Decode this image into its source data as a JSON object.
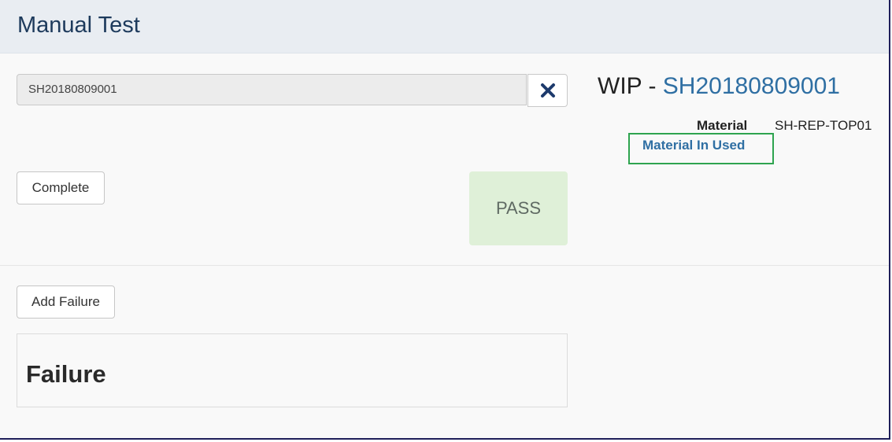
{
  "header": {
    "title": "Manual Test"
  },
  "scan": {
    "value": "SH20180809001",
    "clear_icon": "close-icon"
  },
  "wip": {
    "prefix": "WIP - ",
    "id": "SH20180809001"
  },
  "material": {
    "label": "Material",
    "value": "SH-REP-TOP01",
    "link": "Material In Used"
  },
  "actions": {
    "complete_label": "Complete",
    "add_failure_label": "Add Failure"
  },
  "status": {
    "label": "PASS",
    "color": "#dff0d8"
  },
  "failure": {
    "title": "Failure"
  },
  "colors": {
    "link": "#2f6fa3",
    "highlight_border": "#2ea44f",
    "header_bg": "#e9edf2"
  }
}
